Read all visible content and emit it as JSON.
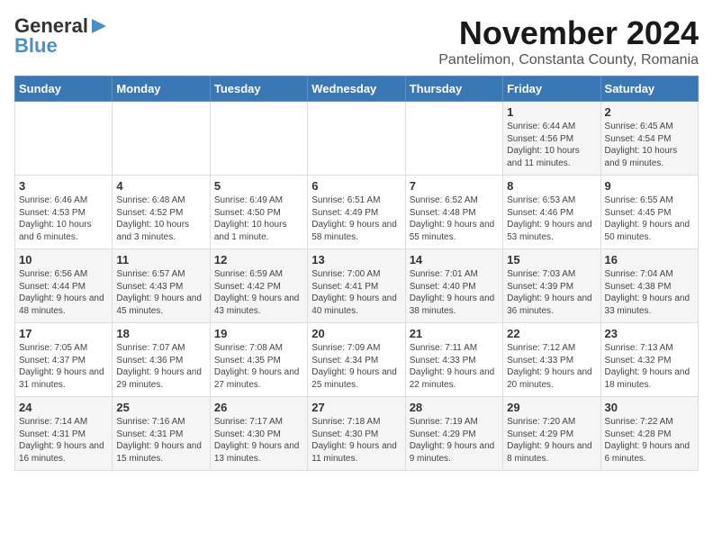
{
  "header": {
    "logo_line1": "General",
    "logo_line2": "Blue",
    "title": "November 2024",
    "subtitle": "Pantelimon, Constanta County, Romania"
  },
  "days_of_week": [
    "Sunday",
    "Monday",
    "Tuesday",
    "Wednesday",
    "Thursday",
    "Friday",
    "Saturday"
  ],
  "weeks": [
    [
      {
        "day": "",
        "info": ""
      },
      {
        "day": "",
        "info": ""
      },
      {
        "day": "",
        "info": ""
      },
      {
        "day": "",
        "info": ""
      },
      {
        "day": "",
        "info": ""
      },
      {
        "day": "1",
        "info": "Sunrise: 6:44 AM\nSunset: 4:56 PM\nDaylight: 10 hours and 11 minutes."
      },
      {
        "day": "2",
        "info": "Sunrise: 6:45 AM\nSunset: 4:54 PM\nDaylight: 10 hours and 9 minutes."
      }
    ],
    [
      {
        "day": "3",
        "info": "Sunrise: 6:46 AM\nSunset: 4:53 PM\nDaylight: 10 hours and 6 minutes."
      },
      {
        "day": "4",
        "info": "Sunrise: 6:48 AM\nSunset: 4:52 PM\nDaylight: 10 hours and 3 minutes."
      },
      {
        "day": "5",
        "info": "Sunrise: 6:49 AM\nSunset: 4:50 PM\nDaylight: 10 hours and 1 minute."
      },
      {
        "day": "6",
        "info": "Sunrise: 6:51 AM\nSunset: 4:49 PM\nDaylight: 9 hours and 58 minutes."
      },
      {
        "day": "7",
        "info": "Sunrise: 6:52 AM\nSunset: 4:48 PM\nDaylight: 9 hours and 55 minutes."
      },
      {
        "day": "8",
        "info": "Sunrise: 6:53 AM\nSunset: 4:46 PM\nDaylight: 9 hours and 53 minutes."
      },
      {
        "day": "9",
        "info": "Sunrise: 6:55 AM\nSunset: 4:45 PM\nDaylight: 9 hours and 50 minutes."
      }
    ],
    [
      {
        "day": "10",
        "info": "Sunrise: 6:56 AM\nSunset: 4:44 PM\nDaylight: 9 hours and 48 minutes."
      },
      {
        "day": "11",
        "info": "Sunrise: 6:57 AM\nSunset: 4:43 PM\nDaylight: 9 hours and 45 minutes."
      },
      {
        "day": "12",
        "info": "Sunrise: 6:59 AM\nSunset: 4:42 PM\nDaylight: 9 hours and 43 minutes."
      },
      {
        "day": "13",
        "info": "Sunrise: 7:00 AM\nSunset: 4:41 PM\nDaylight: 9 hours and 40 minutes."
      },
      {
        "day": "14",
        "info": "Sunrise: 7:01 AM\nSunset: 4:40 PM\nDaylight: 9 hours and 38 minutes."
      },
      {
        "day": "15",
        "info": "Sunrise: 7:03 AM\nSunset: 4:39 PM\nDaylight: 9 hours and 36 minutes."
      },
      {
        "day": "16",
        "info": "Sunrise: 7:04 AM\nSunset: 4:38 PM\nDaylight: 9 hours and 33 minutes."
      }
    ],
    [
      {
        "day": "17",
        "info": "Sunrise: 7:05 AM\nSunset: 4:37 PM\nDaylight: 9 hours and 31 minutes."
      },
      {
        "day": "18",
        "info": "Sunrise: 7:07 AM\nSunset: 4:36 PM\nDaylight: 9 hours and 29 minutes."
      },
      {
        "day": "19",
        "info": "Sunrise: 7:08 AM\nSunset: 4:35 PM\nDaylight: 9 hours and 27 minutes."
      },
      {
        "day": "20",
        "info": "Sunrise: 7:09 AM\nSunset: 4:34 PM\nDaylight: 9 hours and 25 minutes."
      },
      {
        "day": "21",
        "info": "Sunrise: 7:11 AM\nSunset: 4:33 PM\nDaylight: 9 hours and 22 minutes."
      },
      {
        "day": "22",
        "info": "Sunrise: 7:12 AM\nSunset: 4:33 PM\nDaylight: 9 hours and 20 minutes."
      },
      {
        "day": "23",
        "info": "Sunrise: 7:13 AM\nSunset: 4:32 PM\nDaylight: 9 hours and 18 minutes."
      }
    ],
    [
      {
        "day": "24",
        "info": "Sunrise: 7:14 AM\nSunset: 4:31 PM\nDaylight: 9 hours and 16 minutes."
      },
      {
        "day": "25",
        "info": "Sunrise: 7:16 AM\nSunset: 4:31 PM\nDaylight: 9 hours and 15 minutes."
      },
      {
        "day": "26",
        "info": "Sunrise: 7:17 AM\nSunset: 4:30 PM\nDaylight: 9 hours and 13 minutes."
      },
      {
        "day": "27",
        "info": "Sunrise: 7:18 AM\nSunset: 4:30 PM\nDaylight: 9 hours and 11 minutes."
      },
      {
        "day": "28",
        "info": "Sunrise: 7:19 AM\nSunset: 4:29 PM\nDaylight: 9 hours and 9 minutes."
      },
      {
        "day": "29",
        "info": "Sunrise: 7:20 AM\nSunset: 4:29 PM\nDaylight: 9 hours and 8 minutes."
      },
      {
        "day": "30",
        "info": "Sunrise: 7:22 AM\nSunset: 4:28 PM\nDaylight: 9 hours and 6 minutes."
      }
    ]
  ]
}
